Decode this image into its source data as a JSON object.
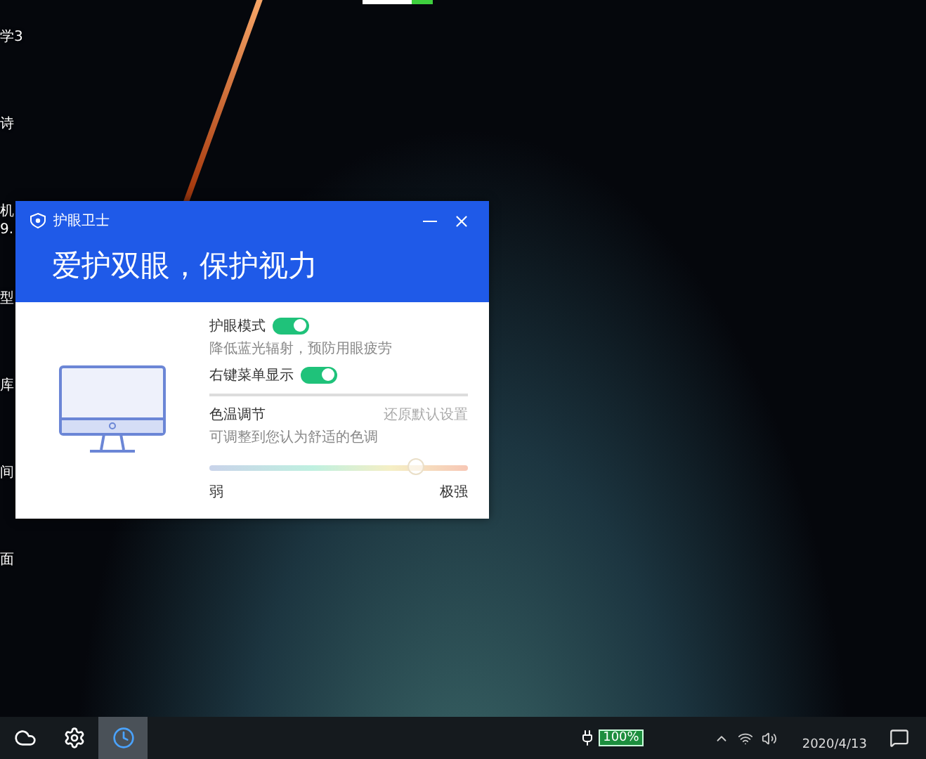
{
  "desktop_icons": [
    {
      "lines": [
        "学3"
      ]
    },
    {
      "lines": [
        "诗"
      ]
    },
    {
      "lines": [
        "机",
        "9."
      ]
    },
    {
      "lines": [
        "型"
      ]
    },
    {
      "lines": [
        "库"
      ]
    },
    {
      "lines": [
        "间"
      ]
    },
    {
      "lines": [
        "面"
      ]
    }
  ],
  "window": {
    "title": "护眼卫士",
    "headline": "爱护双眼，保护视力",
    "settings": [
      {
        "kind": "toggle",
        "label": "护眼模式",
        "on": true,
        "hint": "降低蓝光辐射，预防用眼疲劳"
      },
      {
        "kind": "toggle",
        "label": "右键菜单显示",
        "on": true
      }
    ],
    "color_temperature": {
      "label": "色温调节",
      "reset": "还原默认设置",
      "hint": "可调整到您认为舒适的色调",
      "level": 0.8,
      "min_label": "弱",
      "max_label": "极强"
    }
  },
  "taskbar": {
    "apps": [
      {
        "kind": "weather",
        "selected": false
      },
      {
        "kind": "settings",
        "selected": false
      },
      {
        "kind": "clock",
        "selected": true
      }
    ],
    "battery": "100%",
    "date": "2020/4/13"
  }
}
